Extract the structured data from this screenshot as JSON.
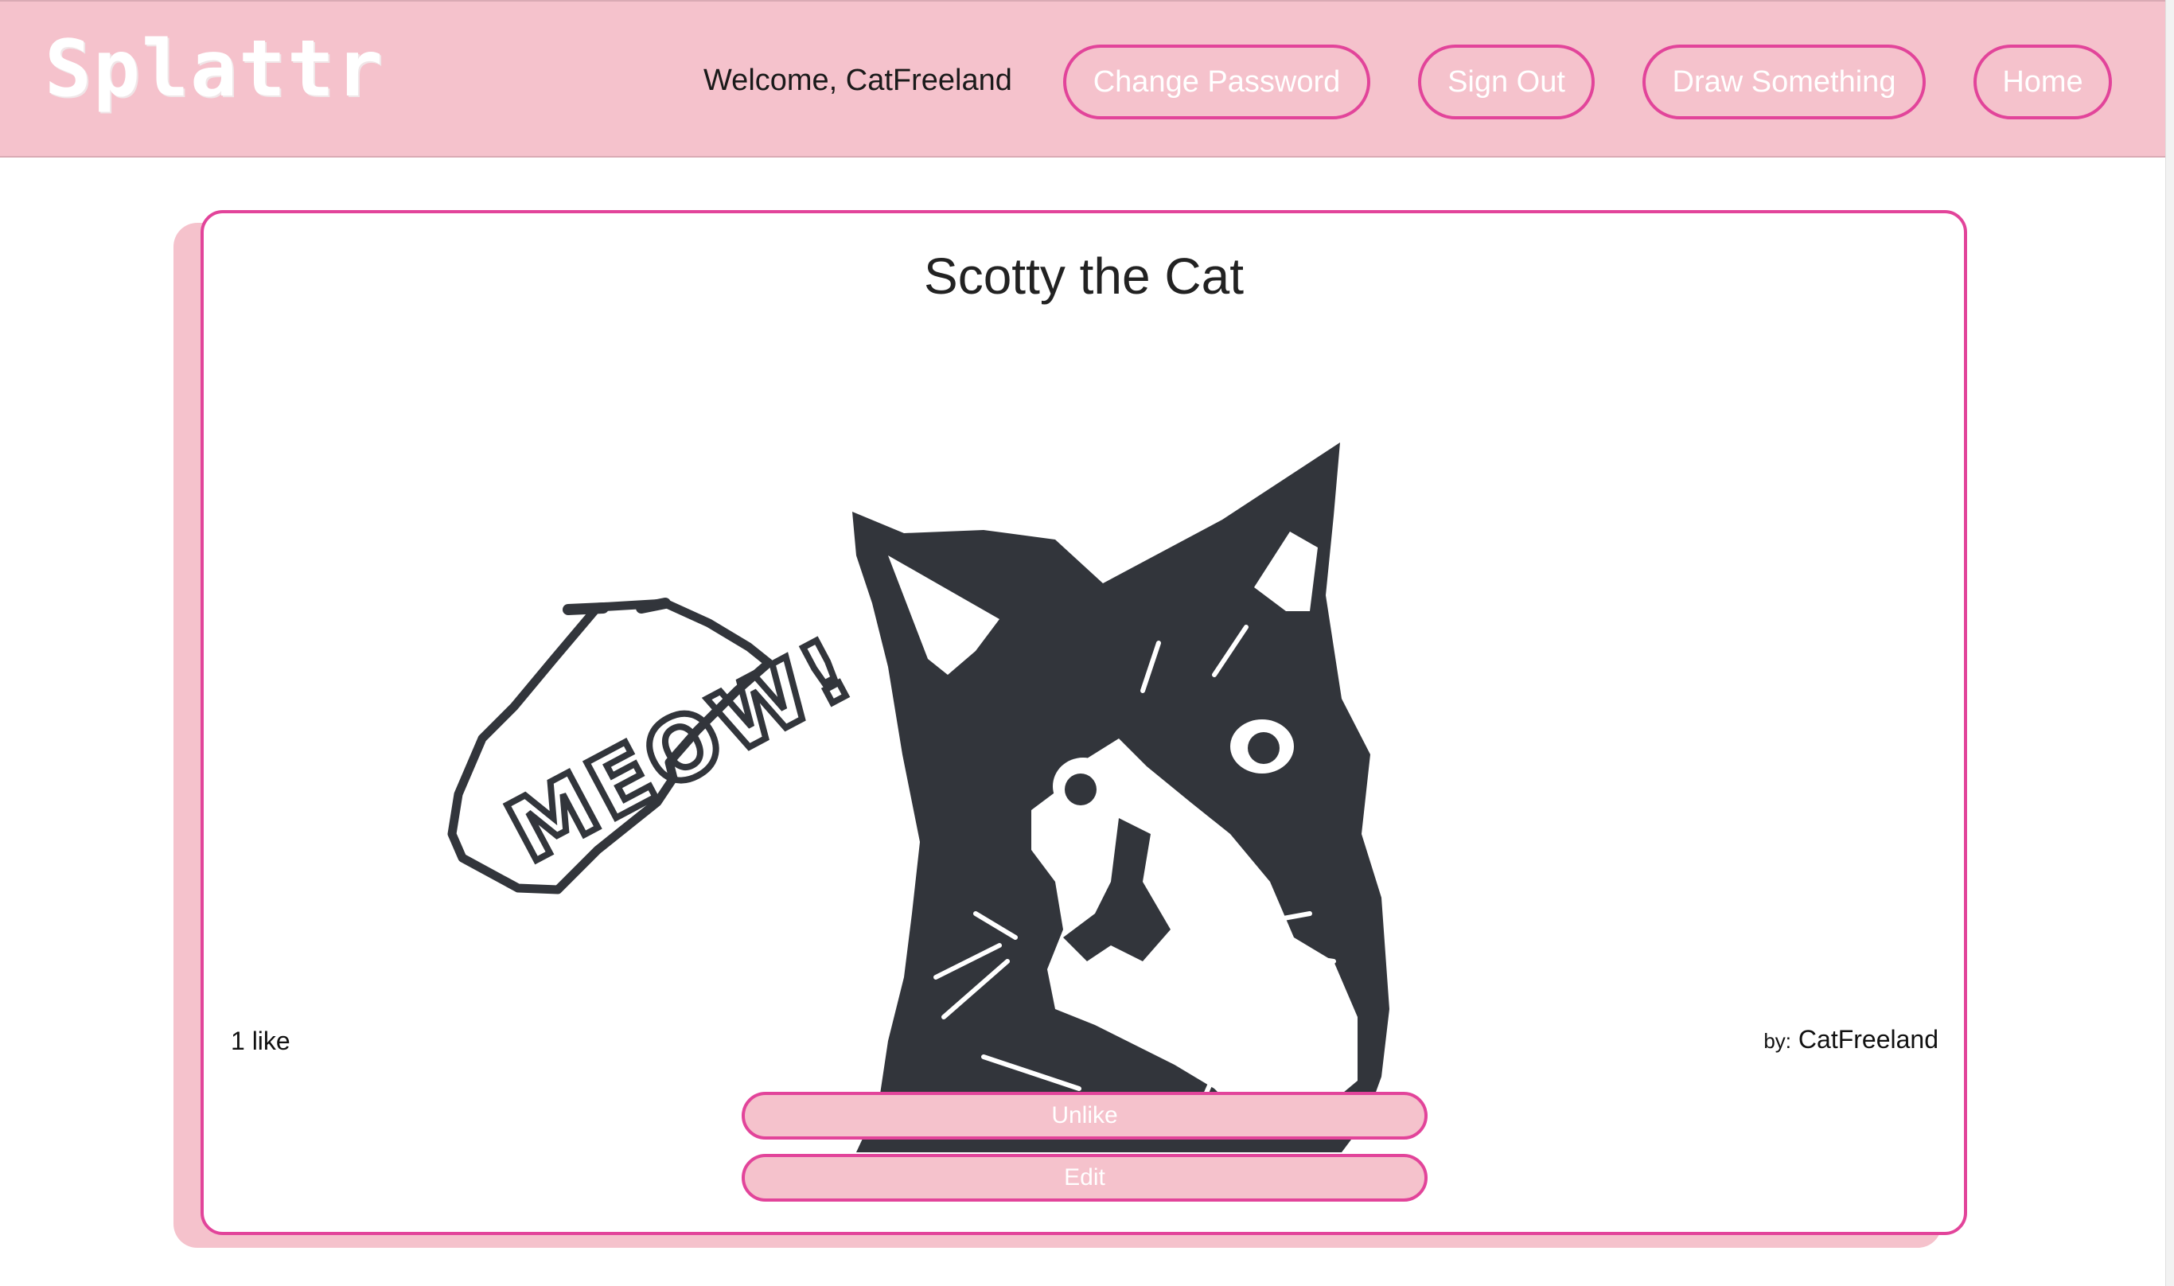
{
  "header": {
    "logo": "Splattr",
    "welcome": "Welcome, CatFreeland",
    "buttons": {
      "change_password": "Change Password",
      "sign_out": "Sign Out",
      "draw_something": "Draw Something",
      "home": "Home"
    }
  },
  "post": {
    "title": "Scotty the Cat",
    "speech_bubble_text": "MEOW!",
    "likes": "1 like",
    "author_prefix": "by:",
    "author": "CatFreeland",
    "actions": {
      "unlike": "Unlike",
      "edit": "Edit"
    }
  },
  "colors": {
    "accent": "#e2449a",
    "pink": "#f5c2cc",
    "ink": "#32353b"
  }
}
